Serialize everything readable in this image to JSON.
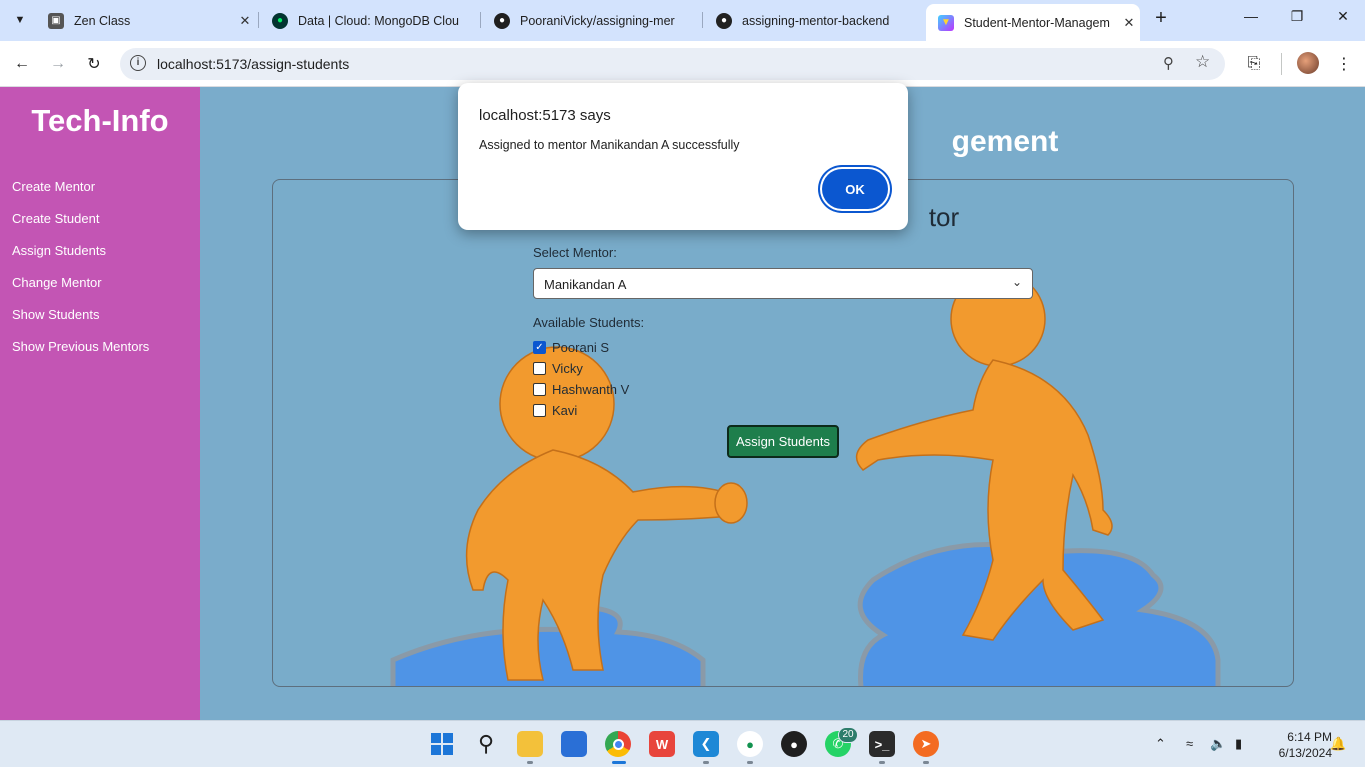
{
  "browser": {
    "tabs": [
      {
        "title": "Zen Class",
        "favicon": "zen-class-favicon"
      },
      {
        "title": "Data | Cloud: MongoDB Clou",
        "favicon": "mongodb-favicon"
      },
      {
        "title": "PooraniVicky/assigning-mer",
        "favicon": "github-favicon"
      },
      {
        "title": "assigning-mentor-backend",
        "favicon": "render-favicon"
      },
      {
        "title": "Student-Mentor-Managem",
        "favicon": "vite-favicon"
      }
    ],
    "url": "localhost:5173/assign-students"
  },
  "sidebar": {
    "brand": "Tech-Info",
    "links": [
      "Create Mentor",
      "Create Student",
      "Assign Students",
      "Change Mentor",
      "Show Students",
      "Show Previous Mentors"
    ]
  },
  "main": {
    "title_visible": "gement",
    "heading_visible": "tor",
    "select_mentor_label": "Select Mentor:",
    "selected_mentor": "Manikandan A",
    "available_students_label": "Available Students:",
    "students": [
      {
        "name": "Poorani S",
        "checked": true
      },
      {
        "name": "Vicky",
        "checked": false
      },
      {
        "name": "Hashwanth V",
        "checked": false
      },
      {
        "name": "Kavi",
        "checked": false
      }
    ],
    "assign_button": "Assign Students"
  },
  "dialog": {
    "title": "localhost:5173 says",
    "message": "Assigned to mentor Manikandan A successfully",
    "ok_label": "OK"
  },
  "taskbar": {
    "whatsapp_badge": "20",
    "time": "6:14 PM",
    "date": "6/13/2024"
  },
  "colors": {
    "sidebar": "#c355b4",
    "page_bg": "#7aaccb",
    "assign_button": "#1e7e4c",
    "ok_button": "#0b57d0"
  }
}
